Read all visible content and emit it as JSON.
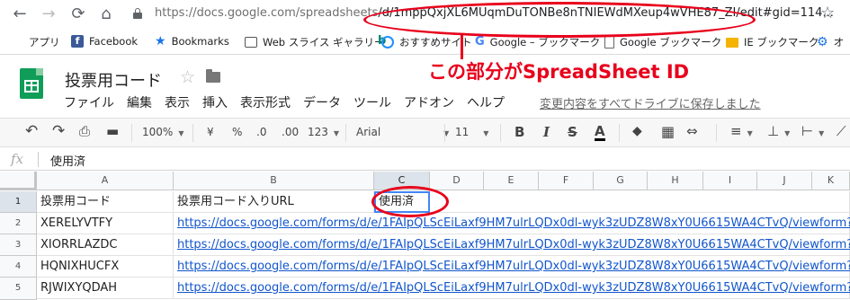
{
  "browser": {
    "url_dim": "https://docs.google.com/spreadsheets",
    "url_main": "/d/1mppQxjXL6MUqmDuTONBe8nTNIEWdMXeup4wVHE87_ZI/edit#gid=114..."
  },
  "bookmarks": [
    {
      "label": "アプリ",
      "icon": "apps-grid-icon"
    },
    {
      "label": "Facebook",
      "icon": "facebook-icon",
      "color": "#3b5998"
    },
    {
      "label": "Bookmarks",
      "icon": "star-icon",
      "color": "#1a73e8"
    },
    {
      "label": "Web スライス ギャラリー",
      "icon": "web-slice-icon"
    },
    {
      "label": "",
      "icon": "bing-icon",
      "color": "#008373"
    },
    {
      "label": "おすすめサイト",
      "icon": "ie-icon",
      "color": "#1e90ff"
    },
    {
      "label": "Google – ブックマーク",
      "icon": "google-icon"
    },
    {
      "label": "Google ブックマーク",
      "icon": "document-icon"
    },
    {
      "label": "IE ブックマーク",
      "icon": "folder-icon",
      "color": "#f4b400"
    },
    {
      "label": "オ",
      "icon": "gear-icon",
      "color": "#1a73e8"
    }
  ],
  "annotation": {
    "text": "この部分がSpreadSheet ID",
    "color": "#e8001b"
  },
  "doc": {
    "title": "投票用コード"
  },
  "menu": [
    "ファイル",
    "編集",
    "表示",
    "挿入",
    "表示形式",
    "データ",
    "ツール",
    "アドオン",
    "ヘルプ"
  ],
  "save_status": "変更内容をすべてドライブに保存しました",
  "toolbar": {
    "zoom": "100%",
    "currency": "¥",
    "percent": "%",
    "dec_less": ".0",
    "dec_more": ".00",
    "more_formats": "123",
    "font": "Arial",
    "font_size": "11",
    "bold": "B",
    "italic": "I",
    "strike": "S",
    "text_color": "A"
  },
  "formula_bar": {
    "value": "使用済"
  },
  "sheet": {
    "columns": [
      "A",
      "B",
      "C",
      "D",
      "E",
      "F",
      "G",
      "H",
      "I",
      "J",
      "K"
    ],
    "rows": [
      "1",
      "2",
      "3",
      "4",
      "5"
    ],
    "header_row": [
      "投票用コード",
      "投票用コード入りURL",
      "使用済"
    ],
    "codes": [
      "XERELYVTFY",
      "XIORRLAZDC",
      "HQNIXHUCFX",
      "RJWIXYQDAH"
    ],
    "url": "https://docs.google.com/forms/d/e/1FAIpQLScEiLaxf9HM7ulrLQDx0dl-wyk3zUDZ8W8xY0U6615WA4CTvQ/viewform?"
  }
}
